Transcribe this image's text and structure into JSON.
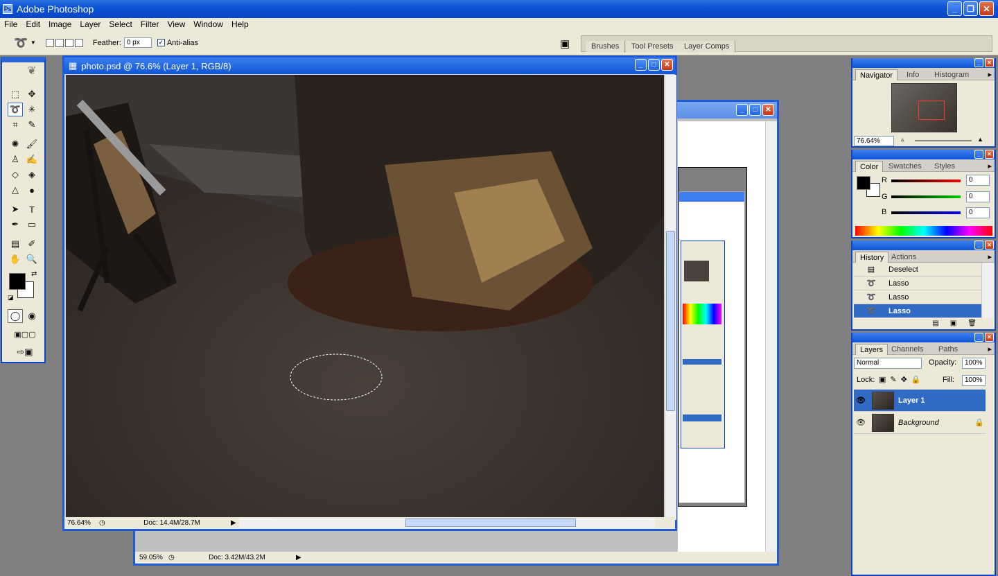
{
  "app": {
    "title": "Adobe Photoshop"
  },
  "menu": [
    "File",
    "Edit",
    "Image",
    "Layer",
    "Select",
    "Filter",
    "View",
    "Window",
    "Help"
  ],
  "options": {
    "feather_label": "Feather:",
    "feather_value": "0 px",
    "antialias_label": "Anti-alias"
  },
  "well_tabs": [
    "Brushes",
    "Tool Presets",
    "Layer Comps"
  ],
  "doc": {
    "title": "photo.psd @ 76.6% (Layer 1, RGB/8)",
    "zoom": "76.64%",
    "docinfo": "Doc: 14.4M/28.7M"
  },
  "doc2": {
    "zoom": "59.05%",
    "docinfo": "Doc: 3.42M/43.2M"
  },
  "navigator": {
    "tabs": [
      "Navigator",
      "Info",
      "Histogram"
    ],
    "zoom": "76.64%"
  },
  "color": {
    "tabs": [
      "Color",
      "Swatches",
      "Styles"
    ],
    "r_label": "R",
    "g_label": "G",
    "b_label": "B",
    "r": "0",
    "g": "0",
    "b": "0"
  },
  "history": {
    "tabs": [
      "History",
      "Actions"
    ],
    "items": [
      "Deselect",
      "Lasso",
      "Lasso",
      "Lasso"
    ]
  },
  "layers": {
    "tabs": [
      "Layers",
      "Channels",
      "Paths"
    ],
    "blend": "Normal",
    "opacity_label": "Opacity:",
    "opacity": "100%",
    "lock_label": "Lock:",
    "fill_label": "Fill:",
    "fill": "100%",
    "items": [
      "Layer 1",
      "Background"
    ]
  },
  "colors": {
    "titlebar": "#0a46c4",
    "selection": "#316ac5"
  }
}
